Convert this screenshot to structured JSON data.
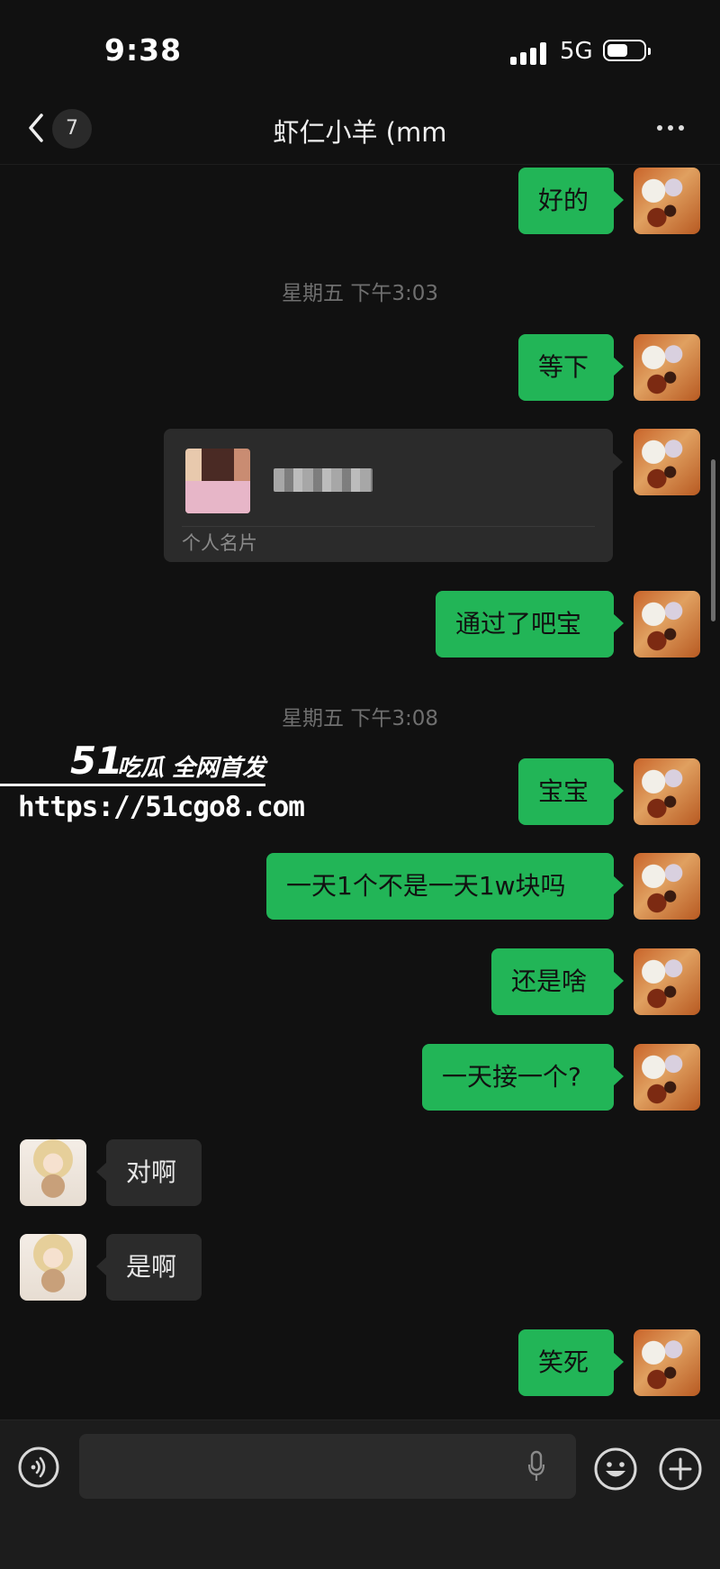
{
  "status": {
    "time": "9:38",
    "network": "5G"
  },
  "nav": {
    "unread_count": "7",
    "title": "虾仁小羊 (mm"
  },
  "timestamps": [
    "星期五 下午3:03",
    "星期五 下午3:08"
  ],
  "messages": {
    "m1": "好的",
    "m2": "等下",
    "card_label": "个人名片",
    "m3": "通过了吧宝",
    "m4": "宝宝",
    "m5": "一天1个不是一天1w块吗",
    "m6": "还是啥",
    "m7": "一天接一个?",
    "h1": "对啊",
    "h2": "是啊",
    "m8": "笑死"
  },
  "watermark": {
    "brand": "51",
    "tag": "吃瓜 全网首发",
    "url": "https://51cgo8.com"
  },
  "icons": [
    "back-icon",
    "more-icon",
    "voice-icon",
    "microphone-icon",
    "emoji-icon",
    "plus-icon"
  ]
}
